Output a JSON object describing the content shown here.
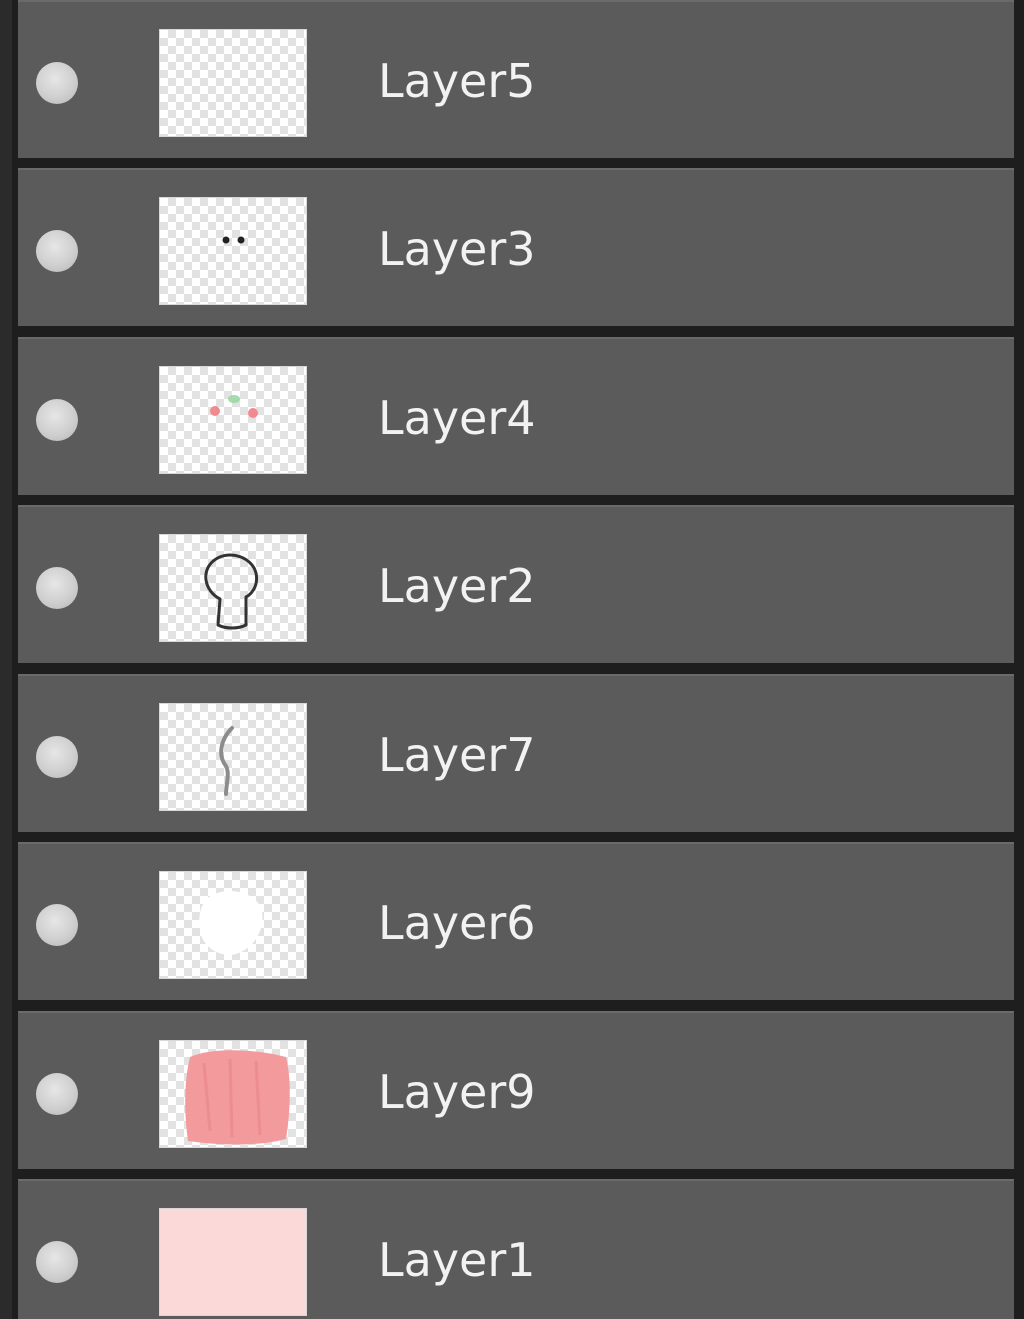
{
  "layers": [
    {
      "name": "Layer5",
      "thumbnail": "empty-transparent",
      "visible": true
    },
    {
      "name": "Layer3",
      "thumbnail": "two-dark-dots",
      "visible": true
    },
    {
      "name": "Layer4",
      "thumbnail": "pink-and-green-dots",
      "visible": true
    },
    {
      "name": "Layer2",
      "thumbnail": "head-outline-sketch",
      "visible": true
    },
    {
      "name": "Layer7",
      "thumbnail": "grey-curve-stroke",
      "visible": true
    },
    {
      "name": "Layer6",
      "thumbnail": "white-blob",
      "visible": true
    },
    {
      "name": "Layer9",
      "thumbnail": "pink-fill-blob",
      "visible": true
    },
    {
      "name": "Layer1",
      "thumbnail": "solid-light-pink",
      "visible": true
    }
  ],
  "colors": {
    "row_background": "#5b5b5b",
    "row_separator": "#1e1e1e",
    "text": "#f2f2f2",
    "pink_fill": "#f39a9c",
    "light_pink": "#fbd9d9"
  }
}
